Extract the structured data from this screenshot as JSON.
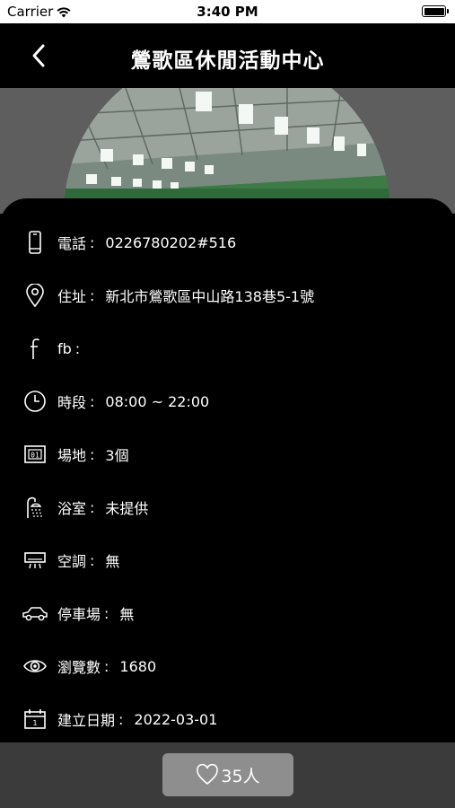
{
  "status_bar": {
    "carrier": "Carrier",
    "time": "3:40 PM"
  },
  "nav": {
    "title": "鶯歌區休閒活動中心"
  },
  "info": [
    {
      "icon": "phone-icon",
      "label": "電話",
      "value": "0226780202#516"
    },
    {
      "icon": "location-pin-icon",
      "label": "住址",
      "value": "新北市鶯歌區中山路138巷5-1號"
    },
    {
      "icon": "facebook-icon",
      "label": "fb",
      "value": ""
    },
    {
      "icon": "clock-icon",
      "label": "時段",
      "value": "08:00 ~ 22:00"
    },
    {
      "icon": "court-icon",
      "label": "場地",
      "value": "3個"
    },
    {
      "icon": "shower-icon",
      "label": "浴室",
      "value": "未提供"
    },
    {
      "icon": "air-conditioner-icon",
      "label": "空調",
      "value": "無"
    },
    {
      "icon": "car-icon",
      "label": "停車場",
      "value": "無"
    },
    {
      "icon": "eye-icon",
      "label": "瀏覽數",
      "value": "1680"
    },
    {
      "icon": "calendar-icon",
      "label": "建立日期",
      "value": "2022-03-01"
    }
  ],
  "like_button": {
    "label": "35人",
    "icon": "heart-icon"
  },
  "colors": {
    "background": "#000000",
    "bottom_bar": "#3b3b3b",
    "button": "#8e8e8e"
  }
}
